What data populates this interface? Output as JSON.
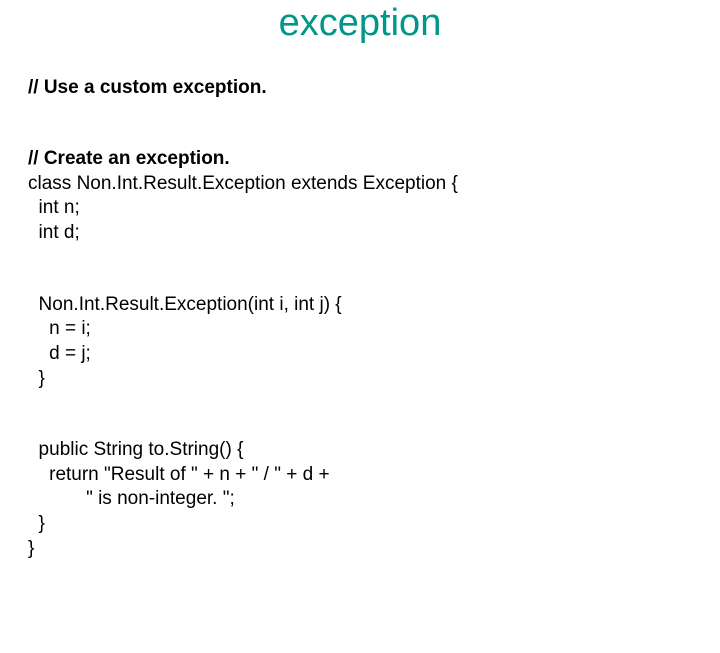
{
  "title": "exception",
  "comment1": "// Use a custom exception.",
  "comment2": "// Create an exception.",
  "classDecl": "class Non.Int.Result.Exception extends Exception {",
  "field1": "  int n;",
  "field2": "  int d;",
  "ctorHead": "  Non.Int.Result.Exception(int i, int j) {",
  "ctorL1": "    n = i;",
  "ctorL2": "    d = j;",
  "ctorClose": "  }",
  "toStrHead": "  public String to.String() {",
  "toStrL1": "    return \"Result of \" + n + \" / \" + d +",
  "toStrL2": "           \" is non-integer. \";",
  "toStrClose": "  }",
  "classClose": "}"
}
